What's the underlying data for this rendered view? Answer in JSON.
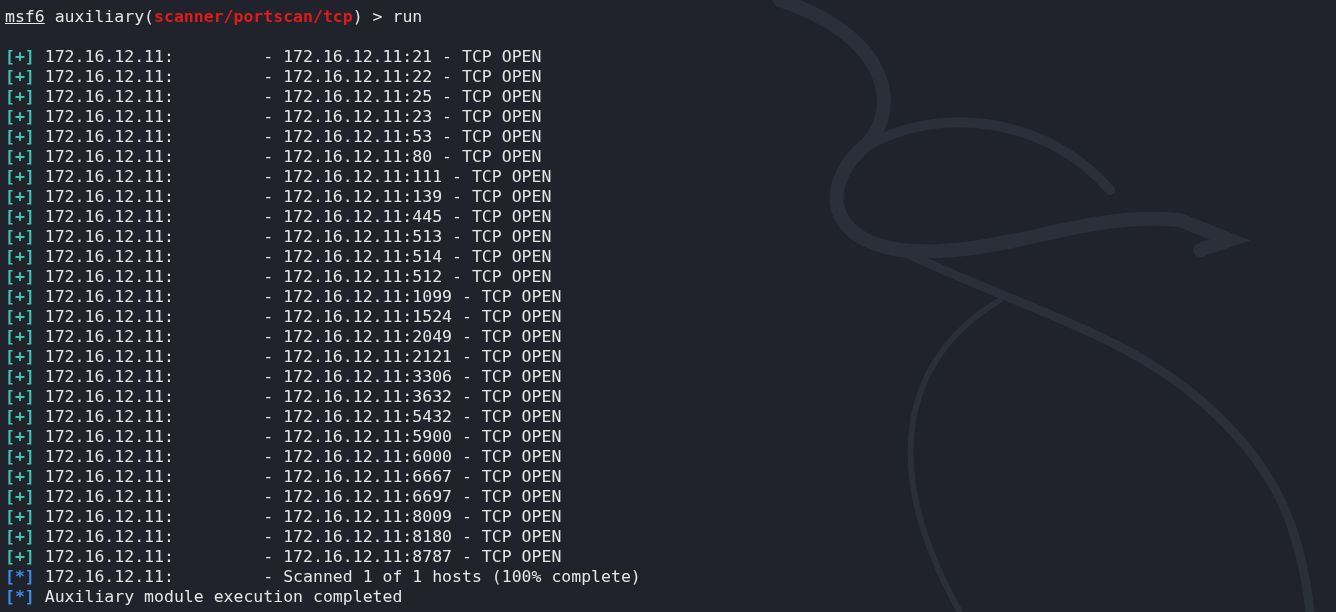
{
  "prompt": {
    "user": "msf6",
    "before": "auxiliary(",
    "module": "scanner/portscan/tcp",
    "after": ") > ",
    "command": "run"
  },
  "output": [
    {
      "kind": "good",
      "marker": "[+]",
      "text": "172.16.12.11:         - 172.16.12.11:21 - TCP OPEN"
    },
    {
      "kind": "good",
      "marker": "[+]",
      "text": "172.16.12.11:         - 172.16.12.11:22 - TCP OPEN"
    },
    {
      "kind": "good",
      "marker": "[+]",
      "text": "172.16.12.11:         - 172.16.12.11:25 - TCP OPEN"
    },
    {
      "kind": "good",
      "marker": "[+]",
      "text": "172.16.12.11:         - 172.16.12.11:23 - TCP OPEN"
    },
    {
      "kind": "good",
      "marker": "[+]",
      "text": "172.16.12.11:         - 172.16.12.11:53 - TCP OPEN"
    },
    {
      "kind": "good",
      "marker": "[+]",
      "text": "172.16.12.11:         - 172.16.12.11:80 - TCP OPEN"
    },
    {
      "kind": "good",
      "marker": "[+]",
      "text": "172.16.12.11:         - 172.16.12.11:111 - TCP OPEN"
    },
    {
      "kind": "good",
      "marker": "[+]",
      "text": "172.16.12.11:         - 172.16.12.11:139 - TCP OPEN"
    },
    {
      "kind": "good",
      "marker": "[+]",
      "text": "172.16.12.11:         - 172.16.12.11:445 - TCP OPEN"
    },
    {
      "kind": "good",
      "marker": "[+]",
      "text": "172.16.12.11:         - 172.16.12.11:513 - TCP OPEN"
    },
    {
      "kind": "good",
      "marker": "[+]",
      "text": "172.16.12.11:         - 172.16.12.11:514 - TCP OPEN"
    },
    {
      "kind": "good",
      "marker": "[+]",
      "text": "172.16.12.11:         - 172.16.12.11:512 - TCP OPEN"
    },
    {
      "kind": "good",
      "marker": "[+]",
      "text": "172.16.12.11:         - 172.16.12.11:1099 - TCP OPEN"
    },
    {
      "kind": "good",
      "marker": "[+]",
      "text": "172.16.12.11:         - 172.16.12.11:1524 - TCP OPEN"
    },
    {
      "kind": "good",
      "marker": "[+]",
      "text": "172.16.12.11:         - 172.16.12.11:2049 - TCP OPEN"
    },
    {
      "kind": "good",
      "marker": "[+]",
      "text": "172.16.12.11:         - 172.16.12.11:2121 - TCP OPEN"
    },
    {
      "kind": "good",
      "marker": "[+]",
      "text": "172.16.12.11:         - 172.16.12.11:3306 - TCP OPEN"
    },
    {
      "kind": "good",
      "marker": "[+]",
      "text": "172.16.12.11:         - 172.16.12.11:3632 - TCP OPEN"
    },
    {
      "kind": "good",
      "marker": "[+]",
      "text": "172.16.12.11:         - 172.16.12.11:5432 - TCP OPEN"
    },
    {
      "kind": "good",
      "marker": "[+]",
      "text": "172.16.12.11:         - 172.16.12.11:5900 - TCP OPEN"
    },
    {
      "kind": "good",
      "marker": "[+]",
      "text": "172.16.12.11:         - 172.16.12.11:6000 - TCP OPEN"
    },
    {
      "kind": "good",
      "marker": "[+]",
      "text": "172.16.12.11:         - 172.16.12.11:6667 - TCP OPEN"
    },
    {
      "kind": "good",
      "marker": "[+]",
      "text": "172.16.12.11:         - 172.16.12.11:6697 - TCP OPEN"
    },
    {
      "kind": "good",
      "marker": "[+]",
      "text": "172.16.12.11:         - 172.16.12.11:8009 - TCP OPEN"
    },
    {
      "kind": "good",
      "marker": "[+]",
      "text": "172.16.12.11:         - 172.16.12.11:8180 - TCP OPEN"
    },
    {
      "kind": "good",
      "marker": "[+]",
      "text": "172.16.12.11:         - 172.16.12.11:8787 - TCP OPEN"
    },
    {
      "kind": "status",
      "marker": "[*]",
      "text": "172.16.12.11:         - Scanned 1 of 1 hosts (100% complete)"
    },
    {
      "kind": "status",
      "marker": "[*]",
      "text": "Auxiliary module execution completed"
    }
  ]
}
